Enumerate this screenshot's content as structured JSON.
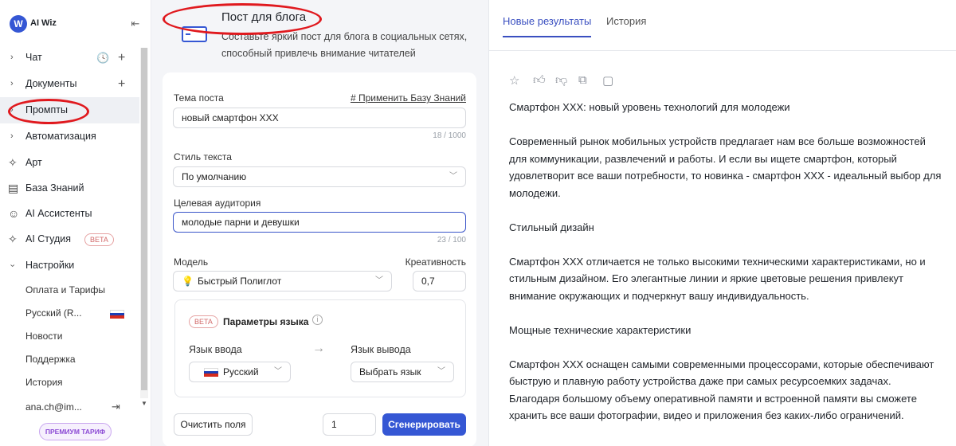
{
  "app": {
    "logo_initial": "W",
    "name": "AI Wiz"
  },
  "sidebar": {
    "items": [
      {
        "label": "Чат",
        "kind": "expand"
      },
      {
        "label": "Документы",
        "kind": "expand"
      },
      {
        "label": "Промпты",
        "kind": "expand",
        "active": true
      },
      {
        "label": "Автоматизация",
        "kind": "expand"
      },
      {
        "label": "Арт",
        "icon": "sparkles-icon"
      },
      {
        "label": "База Знаний",
        "icon": "book-icon"
      },
      {
        "label": "AI Ассистенты",
        "icon": "bot-icon"
      },
      {
        "label": "AI Студия",
        "icon": "sparkles-icon",
        "badge": "BETA"
      },
      {
        "label": "Настройки",
        "kind": "collapse"
      }
    ],
    "settings_items": [
      "Оплата и Тарифы",
      "Русский (R...",
      "Новости",
      "Поддержка",
      "История"
    ],
    "user_email": "ana.ch@im...",
    "premium_label": "ПРЕМИУМ ТАРИФ"
  },
  "header": {
    "title": "Пост для блога",
    "description": "Составьте яркий пост для блога в социальных сетях, способный привлечь внимание читателей"
  },
  "form": {
    "topic_label": "Тема поста",
    "apply_kb_link": "# Применить Базу Знаний",
    "topic_value": "новый смартфон XXX",
    "topic_counter": "18 / 1000",
    "style_label": "Стиль текста",
    "style_value": "По умолчанию",
    "audience_label": "Целевая аудитория",
    "audience_value": "молодые парни и девушки",
    "audience_counter": "23 / 100",
    "model_label": "Модель",
    "model_value": "Быстрый Полиглот",
    "creativity_label": "Креативность",
    "creativity_value": "0,7",
    "lang_params": {
      "badge": "BETA",
      "title": "Параметры языка",
      "input_label": "Язык ввода",
      "input_value": "Русский",
      "output_label": "Язык вывода",
      "output_value": "Выбрать язык"
    },
    "clear_button": "Очистить поля",
    "count_value": "1",
    "generate_button": "Сгенерировать"
  },
  "results": {
    "tabs": [
      "Новые результаты",
      "История"
    ],
    "paragraphs": [
      "Смартфон XXX: новый уровень технологий для молодежи",
      "Современный рынок мобильных устройств предлагает нам все больше возможностей для коммуникации, развлечений и работы. И если вы ищете смартфон, который удовлетворит все ваши потребности, то новинка - смартфон XXX - идеальный выбор для молодежи.",
      "Стильный дизайн",
      "Смартфон XXX отличается не только высокими техническими характеристиками, но и стильным дизайном. Его элегантные линии и яркие цветовые решения привлекут внимание окружающих и подчеркнут вашу индивидуальность.",
      "Мощные технические характеристики",
      "Смартфон XXX оснащен самыми современными процессорами, которые обеспечивают быструю и плавную работу устройства даже при самых ресурсоемких задачах. Благодаря большому объему оперативной памяти и встроенной памяти вы сможете хранить все ваши фотографии, видео и приложения без каких-либо ограничений."
    ]
  },
  "colors": {
    "accent": "#3557d4",
    "annotation": "#e0191e",
    "premium": "#8b4ad4"
  }
}
